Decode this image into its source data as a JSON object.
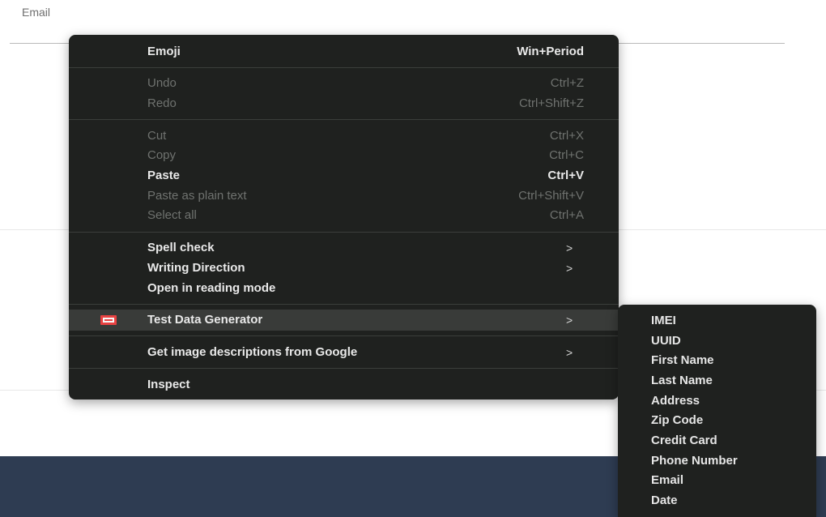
{
  "form": {
    "email_label": "Email"
  },
  "context_menu": {
    "items": [
      {
        "label": "Emoji",
        "shortcut": "Win+Period",
        "disabled": false
      },
      {
        "label": "Undo",
        "shortcut": "Ctrl+Z",
        "disabled": true
      },
      {
        "label": "Redo",
        "shortcut": "Ctrl+Shift+Z",
        "disabled": true
      },
      {
        "label": "Cut",
        "shortcut": "Ctrl+X",
        "disabled": true
      },
      {
        "label": "Copy",
        "shortcut": "Ctrl+C",
        "disabled": true
      },
      {
        "label": "Paste",
        "shortcut": "Ctrl+V",
        "disabled": false
      },
      {
        "label": "Paste as plain text",
        "shortcut": "Ctrl+Shift+V",
        "disabled": true
      },
      {
        "label": "Select all",
        "shortcut": "Ctrl+A",
        "disabled": true
      },
      {
        "label": "Spell check",
        "submenu": true
      },
      {
        "label": "Writing Direction",
        "submenu": true
      },
      {
        "label": "Open in reading mode"
      },
      {
        "label": "Test Data Generator",
        "submenu": true,
        "highlighted": true,
        "icon": "test-data-generator-icon"
      },
      {
        "label": "Get image descriptions from Google",
        "submenu": true
      },
      {
        "label": "Inspect"
      }
    ],
    "chevron": ">"
  },
  "submenu": {
    "items": [
      "IMEI",
      "UUID",
      "First Name",
      "Last Name",
      "Address",
      "Zip Code",
      "Credit Card",
      "Phone Number",
      "Email",
      "Date"
    ]
  },
  "colors": {
    "menu_background": "#1f211f",
    "highlight": "#393b39",
    "footer": "#2e3c52",
    "icon_red": "#e94242"
  }
}
